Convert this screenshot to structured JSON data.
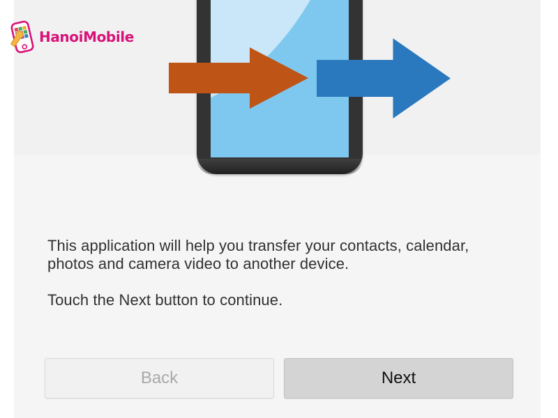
{
  "app": {
    "screen_name": "Transfer wizard intro",
    "background_color": "#f5f5f5"
  },
  "watermark": {
    "brand_name": "HanoiMobile",
    "brand_color": "#d6006e",
    "icon": "smartphone-wrench-icon"
  },
  "illustration": {
    "name": "phone-transfer-illustration",
    "phone_body_color": "#333333",
    "screen_color": "#7ec8ef",
    "screen_highlight_color": "#c9e7f8",
    "incoming_arrow": {
      "name": "orange-arrow-icon",
      "color": "#bf5417",
      "direction": "right"
    },
    "outgoing_arrow": {
      "name": "blue-arrow-icon",
      "color": "#2a79be",
      "direction": "right"
    }
  },
  "content": {
    "paragraph_1": "This application will help you transfer your contacts, calendar, photos and camera video to another device.",
    "paragraph_2": "Touch the Next button to continue."
  },
  "footer": {
    "back_label": "Back",
    "back_enabled": false,
    "next_label": "Next",
    "next_enabled": true
  }
}
